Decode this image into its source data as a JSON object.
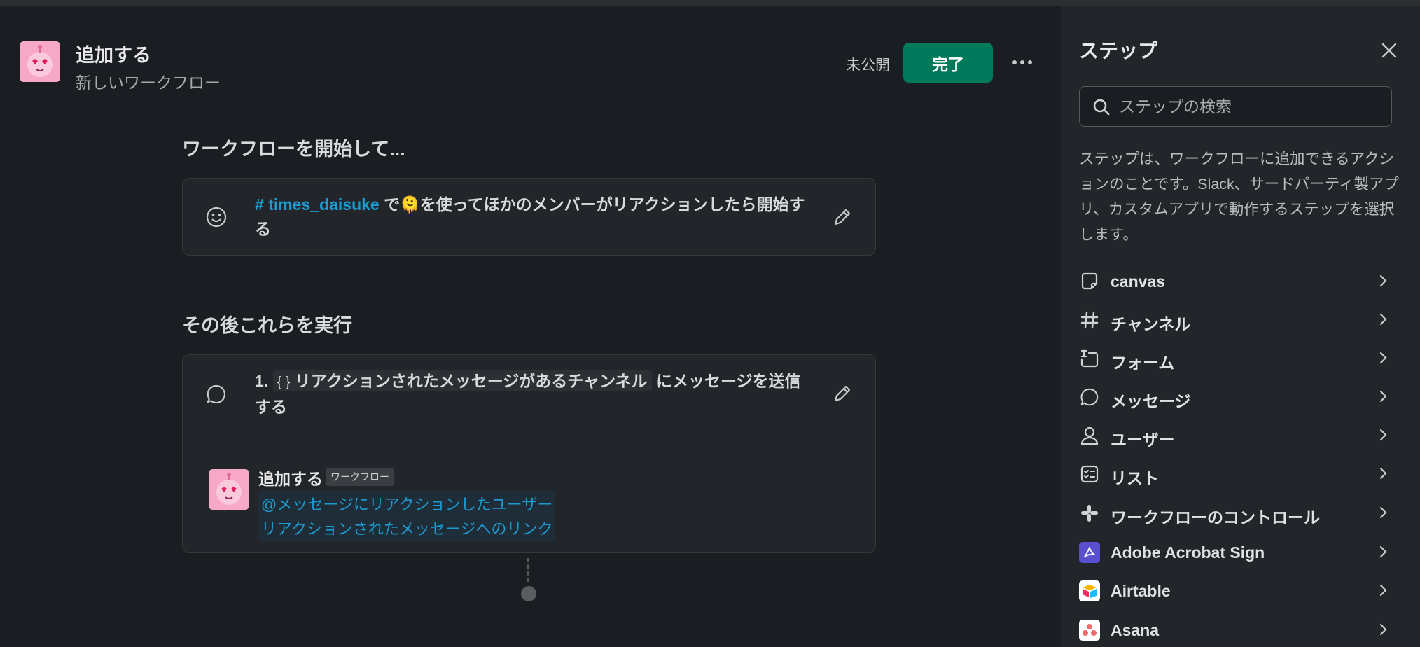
{
  "header": {
    "title": "追加する",
    "subtitle": "新しいワークフロー",
    "status": "未公開",
    "done_label": "完了"
  },
  "trigger": {
    "section_title": "ワークフローを開始して...",
    "channel": "# times_daisuke",
    "text_after_channel": " で",
    "emoji": "🫠",
    "text_rest": "を使ってほかのメンバーがリアクションしたら開始する"
  },
  "steps": {
    "section_title": "その後これらを実行",
    "step_number": "1.",
    "variable_icon": "{ }",
    "variable_name": "リアクションされたメッセージがあるチャンネル",
    "text_rest": " にメッセージを送信する",
    "message": {
      "sender": "追加する",
      "badge": "ワークフロー",
      "line1": "@メッセージにリアクションしたユーザー",
      "line2": "リアクションされたメッセージへのリンク"
    }
  },
  "panel": {
    "title": "ステップ",
    "search_placeholder": "ステップの検索",
    "description": "ステップは、ワークフローに追加できるアクションのことです。Slack、サードパーティ製アプリ、カスタムアプリで動作するステップを選択します。",
    "items": [
      {
        "label": "canvas",
        "icon": "canvas-icon"
      },
      {
        "label": "チャンネル",
        "icon": "hash-icon"
      },
      {
        "label": "フォーム",
        "icon": "form-icon"
      },
      {
        "label": "メッセージ",
        "icon": "message-icon"
      },
      {
        "label": "ユーザー",
        "icon": "user-icon"
      },
      {
        "label": "リスト",
        "icon": "list-icon"
      },
      {
        "label": "ワークフローのコントロール",
        "icon": "slack-logo-icon"
      },
      {
        "label": "Adobe Acrobat Sign",
        "icon": "adobe-acrobat-sign-logo-icon"
      },
      {
        "label": "Airtable",
        "icon": "airtable-logo-icon"
      },
      {
        "label": "Asana",
        "icon": "asana-logo-icon"
      }
    ]
  },
  "colors": {
    "background": "#1a1d21",
    "panel": "#222529",
    "accent_green": "#007a5a",
    "link_blue": "#1d9bd1"
  }
}
